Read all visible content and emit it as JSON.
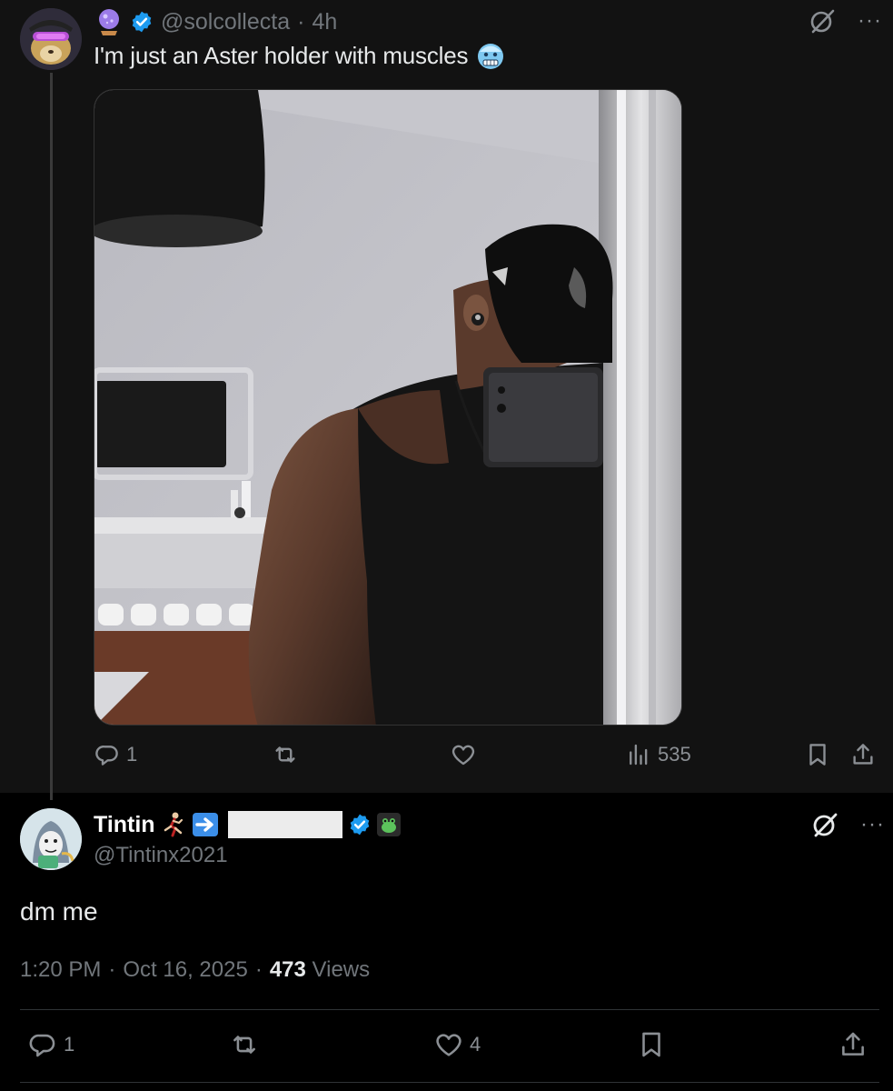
{
  "parent_tweet": {
    "handle": "@solcollecta",
    "separator": "·",
    "time": "4h",
    "text": "I'm just an Aster holder with muscles",
    "more": "···",
    "actions": {
      "replies": "1",
      "views": "535"
    }
  },
  "reply_tweet": {
    "name": "Tintin",
    "handle": "@Tintinx2021",
    "more": "···",
    "text": "dm me",
    "time": "1:20 PM",
    "sep1": "·",
    "date": "Oct 16, 2025",
    "sep2": "·",
    "views_count": "473",
    "views_label": "Views",
    "actions": {
      "replies": "1",
      "likes": "4"
    }
  },
  "colors": {
    "background": "#000000",
    "parent_background": "#121212",
    "muted_text": "#71767b",
    "verified_blue": "#1d9bf0",
    "primary_text": "#e7e9ea"
  },
  "icons": [
    "orb-icon",
    "verified-icon",
    "cold-face-icon",
    "grok-icon",
    "more-icon",
    "reply-icon",
    "retweet-icon",
    "like-icon",
    "views-icon",
    "bookmark-icon",
    "share-icon",
    "runner-icon",
    "arrow-right-icon",
    "frog-icon"
  ]
}
